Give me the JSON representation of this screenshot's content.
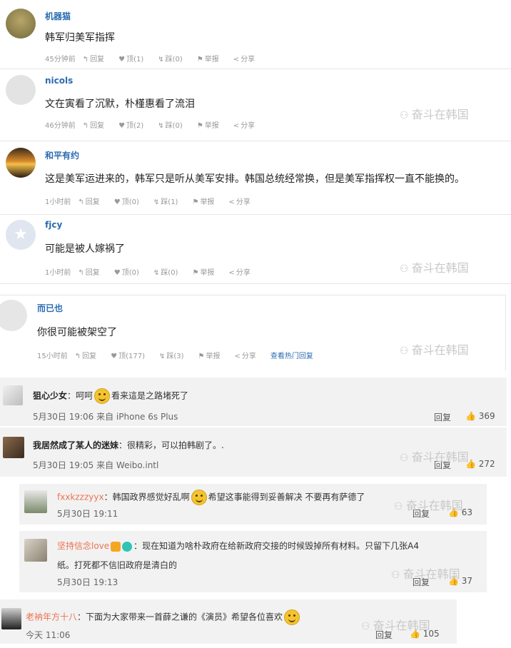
{
  "watermark": "奋斗在韩国",
  "comments": [
    {
      "user": "机器猫",
      "text": "韩军归美军指挥",
      "time": "45分钟前",
      "reply": "回复",
      "up": "顶(1)",
      "down": "踩(0)",
      "report": "举报",
      "share": "分享"
    },
    {
      "user": "nicols",
      "text": "文在寅看了沉默，朴槿惠看了流泪",
      "time": "46分钟前",
      "reply": "回复",
      "up": "顶(2)",
      "down": "踩(0)",
      "report": "举报",
      "share": "分享"
    },
    {
      "user": "和平有约",
      "text": "这是美军运进来的，韩军只是听从美军安排。韩国总统经常换，但是美军指挥权一直不能换的。",
      "time": "1小时前",
      "reply": "回复",
      "up": "顶(0)",
      "down": "踩(1)",
      "report": "举报",
      "share": "分享"
    },
    {
      "user": "fjcy",
      "text": "可能是被人嫁祸了",
      "time": "1小时前",
      "reply": "回复",
      "up": "顶(0)",
      "down": "踩(0)",
      "report": "举报",
      "share": "分享"
    },
    {
      "user": "而已也",
      "text": "你很可能被架空了",
      "time": "15小时前",
      "reply": "回复",
      "up": "顶(177)",
      "down": "踩(3)",
      "report": "举报",
      "share": "分享",
      "hot": "查看热门回复"
    }
  ],
  "weibo": [
    {
      "user": "狙心少女",
      "text_a": "：呵呵",
      "text_b": "看来這是之路堵死了",
      "time": "5月30日 19:06 来自 iPhone 6s Plus",
      "reply": "回复",
      "likes": "369"
    },
    {
      "user": "我居然成了某人的迷妹",
      "text_a": "：很精彩，可以拍韩剧了。.",
      "time": "5月30日 19:05 来自 Weibo.intl",
      "reply": "回复",
      "likes": "272"
    },
    {
      "user": "fxxkzzzyyx",
      "text_a": "：韩国政界感觉好乱啊",
      "text_b": "希望这事能得到妥善解决 不要再有萨德了",
      "time": "5月30日 19:11",
      "reply": "回复",
      "likes": "63"
    },
    {
      "user": "坚持信念love",
      "text_a": "：现在知道为啥朴政府在给新政府交接的时候毁掉所有材料。只留下几张A4",
      "text_b": "纸。打死都不信旧政府是清白的",
      "time": "5月30日 19:13",
      "reply": "回复",
      "likes": "37"
    },
    {
      "user": "老衲年方十八",
      "text_a": "：下面为大家带来一首薛之谦的《演员》希望各位喜欢",
      "time": "今天 11:06",
      "reply": "回复",
      "likes": "105"
    }
  ]
}
